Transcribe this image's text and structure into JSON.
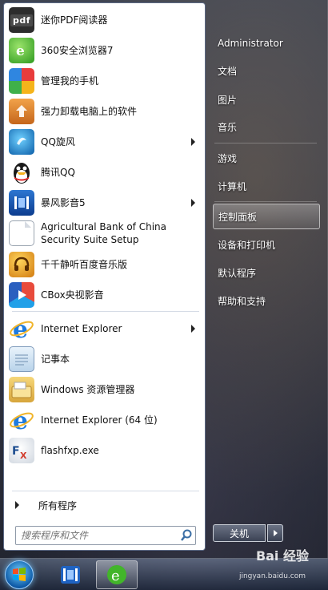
{
  "programs": [
    {
      "label": "迷你PDF阅读器",
      "icon": "pdf-reader-icon",
      "badge": "pdf"
    },
    {
      "label": "360安全浏览器7",
      "icon": "360-browser-icon"
    },
    {
      "label": "管理我的手机",
      "icon": "phone-manager-icon"
    },
    {
      "label": "强力卸载电脑上的软件",
      "icon": "uninstaller-icon"
    },
    {
      "label": "QQ旋风",
      "icon": "qq-whirlwind-icon",
      "submenu": true
    },
    {
      "label": "腾讯QQ",
      "icon": "tencent-qq-icon"
    },
    {
      "label": "暴风影音5",
      "icon": "baofeng-player-icon",
      "submenu": true
    },
    {
      "label_line1": "Agricultural Bank of China",
      "label_line2": "Security Suite Setup",
      "icon": "document-icon"
    },
    {
      "label": "千千静听百度音乐版",
      "icon": "ttplayer-icon"
    },
    {
      "label": "CBox央视影音",
      "icon": "cbox-icon"
    },
    {
      "label": "Internet Explorer",
      "icon": "ie-icon",
      "submenu": true
    },
    {
      "label": "记事本",
      "icon": "notepad-icon"
    },
    {
      "label": "Windows 资源管理器",
      "icon": "windows-explorer-icon"
    },
    {
      "label": "Internet Explorer (64 位)",
      "icon": "ie-icon"
    },
    {
      "label": "flashfxp.exe",
      "icon": "flashfxp-icon"
    }
  ],
  "all_programs_label": "所有程序",
  "search": {
    "placeholder": "搜索程序和文件"
  },
  "right_pane": {
    "user": "Administrator",
    "items": [
      "文档",
      "图片",
      "音乐",
      "游戏",
      "计算机",
      "控制面板",
      "设备和打印机",
      "默认程序",
      "帮助和支持"
    ],
    "selected": "控制面板"
  },
  "shutdown_label": "关机",
  "watermark": {
    "brand": "Bai 经验",
    "url": "jingyan.baidu.com"
  },
  "colors": {
    "accent": "#1e6fd0",
    "menu_border": "#5d6a86"
  }
}
